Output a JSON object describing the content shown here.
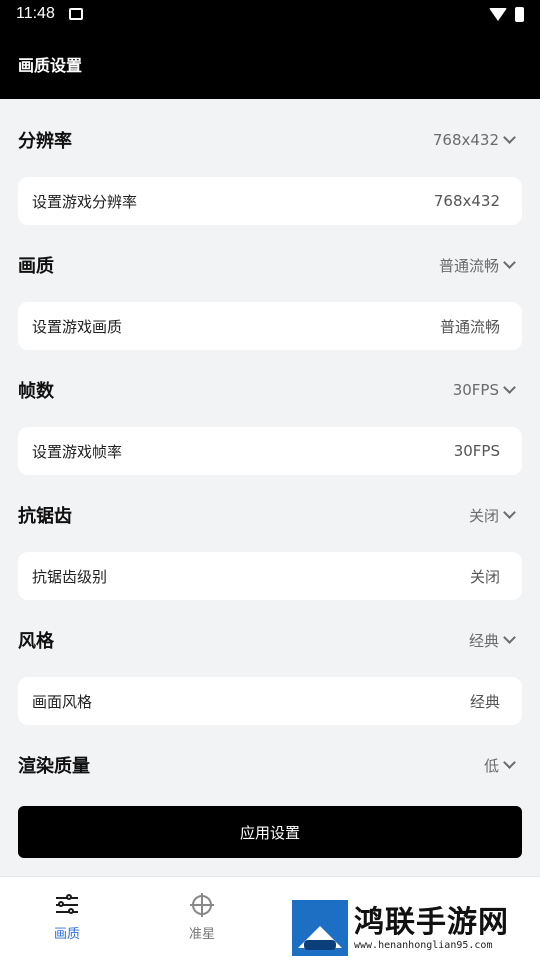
{
  "status_bar": {
    "time": "11:48"
  },
  "app_bar": {
    "title": "画质设置"
  },
  "sections": [
    {
      "title": "分辨率",
      "value": "768x432",
      "card_label": "设置游戏分辨率",
      "card_value": "768x432"
    },
    {
      "title": "画质",
      "value": "普通流畅",
      "card_label": "设置游戏画质",
      "card_value": "普通流畅"
    },
    {
      "title": "帧数",
      "value": "30FPS",
      "card_label": "设置游戏帧率",
      "card_value": "30FPS"
    },
    {
      "title": "抗锯齿",
      "value": "关闭",
      "card_label": "抗锯齿级别",
      "card_value": "关闭"
    },
    {
      "title": "风格",
      "value": "经典",
      "card_label": "画面风格",
      "card_value": "经典"
    },
    {
      "title": "渲染质量",
      "value": "低"
    }
  ],
  "apply_button": "应用设置",
  "bottom_nav": [
    {
      "label": "画质",
      "icon": "sliders-icon",
      "active": true
    },
    {
      "label": "准星",
      "icon": "crosshair-icon",
      "active": false
    }
  ],
  "watermark": {
    "title": "鸿联手游网",
    "url": "www.henanhonglian95.com"
  },
  "colors": {
    "accent": "#2f6fe0",
    "header": "#000000",
    "background": "#f2f3f5"
  }
}
